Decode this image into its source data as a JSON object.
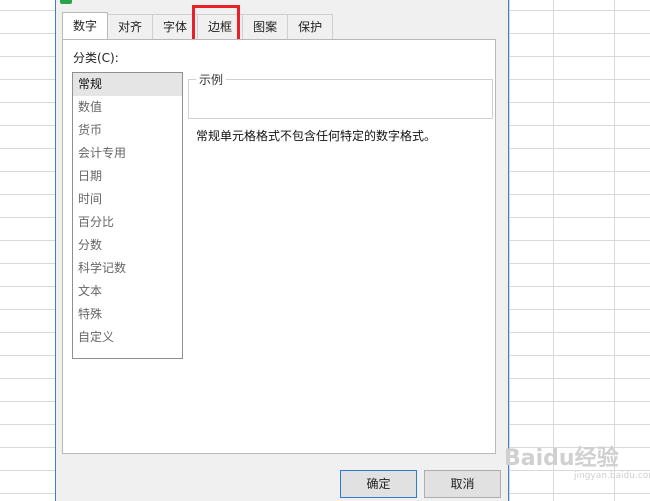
{
  "tabs": [
    {
      "label": "数字",
      "active": true
    },
    {
      "label": "对齐"
    },
    {
      "label": "字体"
    },
    {
      "label": "边框",
      "highlighted": true
    },
    {
      "label": "图案"
    },
    {
      "label": "保护"
    }
  ],
  "category_label": "分类(C):",
  "categories": [
    "常规",
    "数值",
    "货币",
    "会计专用",
    "日期",
    "时间",
    "百分比",
    "分数",
    "科学记数",
    "文本",
    "特殊",
    "自定义"
  ],
  "selected_category": "常规",
  "sample_label": "示例",
  "description": "常规单元格格式不包含任何特定的数字格式。",
  "buttons": {
    "ok": "确定",
    "cancel": "取消"
  },
  "watermark": {
    "text": "Baidu经验",
    "sub": "jingyan.baidu.com"
  },
  "colors": {
    "highlight_box": "#e8202a",
    "dialog_border": "#3c7fd0",
    "app_icon": "#2aa34a"
  }
}
